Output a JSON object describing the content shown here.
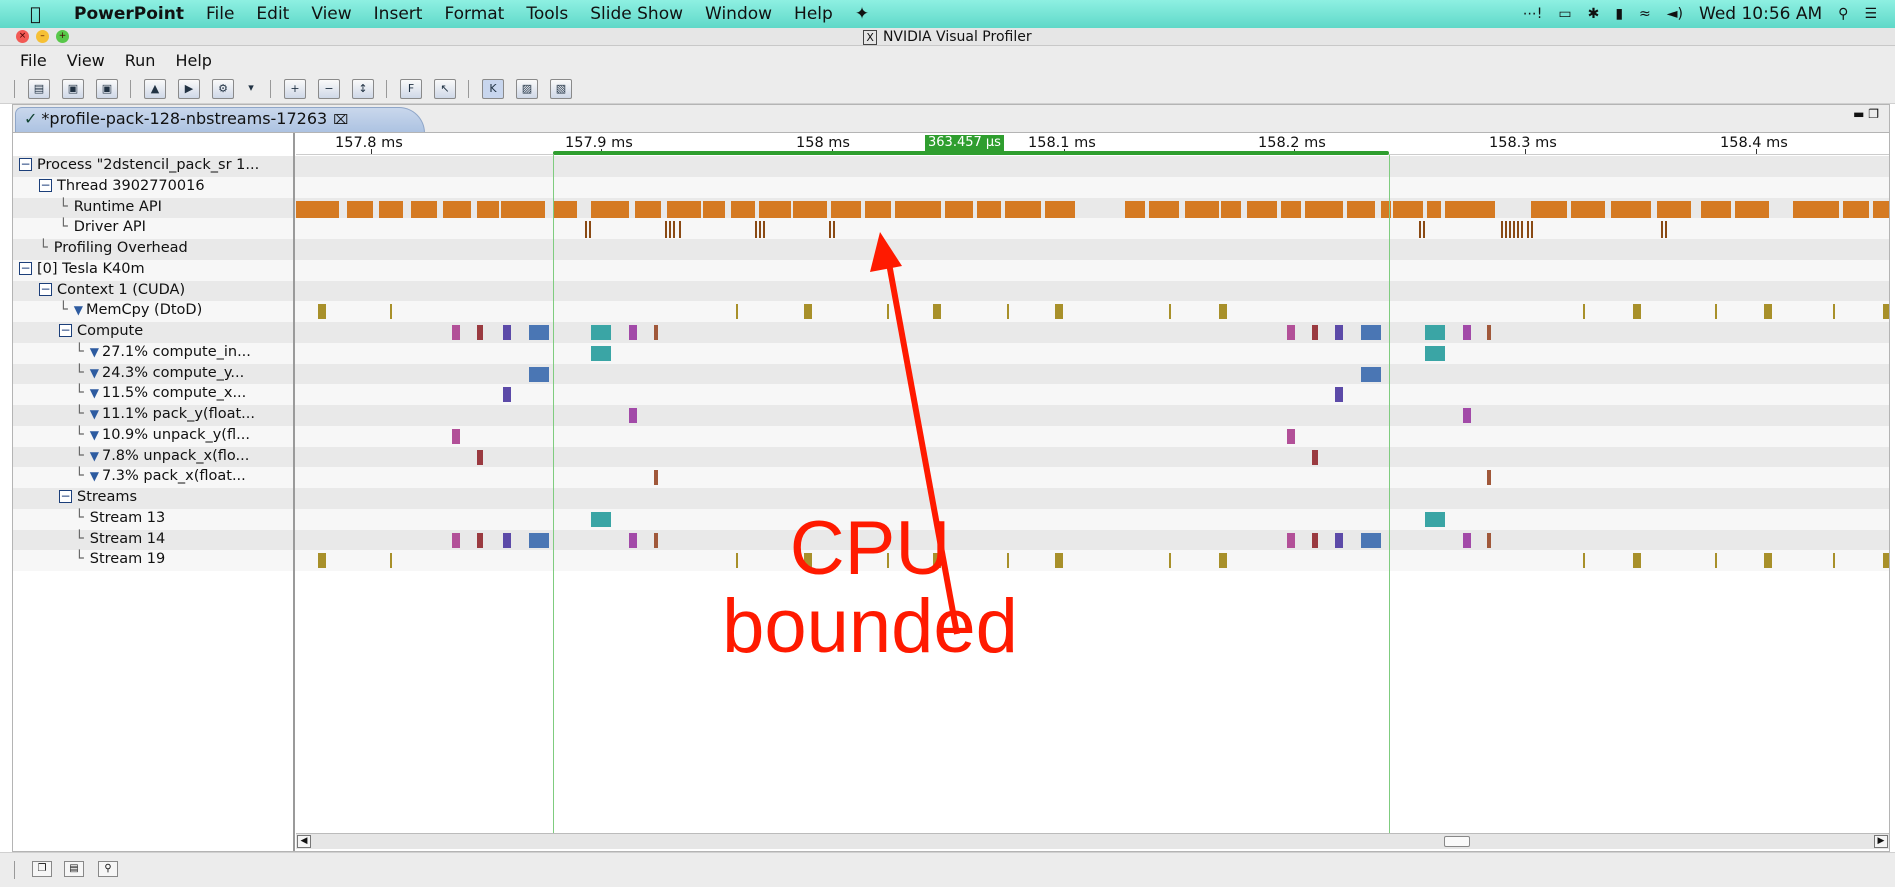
{
  "menubar": {
    "app": "PowerPoint",
    "items": [
      "File",
      "Edit",
      "View",
      "Insert",
      "Format",
      "Tools",
      "Slide Show",
      "Window",
      "Help"
    ],
    "clock": "Wed 10:56 AM"
  },
  "window": {
    "title": "NVIDIA Visual Profiler"
  },
  "app_menu": {
    "items": [
      "File",
      "View",
      "Run",
      "Help"
    ]
  },
  "tab": {
    "label": "*profile-pack-128-nbstreams-17263"
  },
  "ruler": {
    "ticks": [
      "157.8 ms",
      "157.9 ms",
      "158 ms",
      "158.1 ms",
      "158.2 ms",
      "158.3 ms",
      "158.4 ms"
    ],
    "selection_label": "363.457 µs"
  },
  "tree": {
    "rows": [
      {
        "label": "Process \"2dstencil_pack_sr 1...",
        "toggle": true,
        "funnel": false,
        "corner": false
      },
      {
        "label": "Thread 3902770016",
        "toggle": true,
        "funnel": false,
        "corner": false
      },
      {
        "label": "Runtime API",
        "toggle": false,
        "funnel": false,
        "corner": true
      },
      {
        "label": "Driver API",
        "toggle": false,
        "funnel": false,
        "corner": true
      },
      {
        "label": "Profiling Overhead",
        "toggle": false,
        "funnel": false,
        "corner": true
      },
      {
        "label": "[0] Tesla K40m",
        "toggle": true,
        "funnel": false,
        "corner": false
      },
      {
        "label": "Context 1 (CUDA)",
        "toggle": true,
        "funnel": false,
        "corner": false
      },
      {
        "label": "MemCpy (DtoD)",
        "toggle": false,
        "funnel": true,
        "corner": true
      },
      {
        "label": "Compute",
        "toggle": true,
        "funnel": false,
        "corner": false
      },
      {
        "label": "27.1% compute_in...",
        "toggle": false,
        "funnel": true,
        "corner": true
      },
      {
        "label": "24.3% compute_y...",
        "toggle": false,
        "funnel": true,
        "corner": true
      },
      {
        "label": "11.5% compute_x...",
        "toggle": false,
        "funnel": true,
        "corner": true
      },
      {
        "label": "11.1% pack_y(float...",
        "toggle": false,
        "funnel": true,
        "corner": true
      },
      {
        "label": "10.9% unpack_y(fl...",
        "toggle": false,
        "funnel": true,
        "corner": true
      },
      {
        "label": "7.8% unpack_x(flo...",
        "toggle": false,
        "funnel": true,
        "corner": true
      },
      {
        "label": "7.3% pack_x(float...",
        "toggle": false,
        "funnel": true,
        "corner": true
      },
      {
        "label": "Streams",
        "toggle": true,
        "funnel": false,
        "corner": false
      },
      {
        "label": "Stream 13",
        "toggle": false,
        "funnel": false,
        "corner": true
      },
      {
        "label": "Stream 14",
        "toggle": false,
        "funnel": false,
        "corner": true
      },
      {
        "label": "Stream 19",
        "toggle": false,
        "funnel": false,
        "corner": true
      }
    ]
  },
  "colors": {
    "runtime_api": "#d57a22",
    "driver_api": "#8a4a14",
    "memcpy": "#a8902a",
    "compute_in": "#3aa5a5",
    "compute_y": "#4a76b4",
    "compute_x": "#5c4aa8",
    "pack_y": "#a24aa8",
    "unpack_y": "#b25098",
    "unpack_x": "#9a3a40",
    "pack_x": "#a0583a",
    "selection": "#2f9e2f",
    "annotation": "#ff1a00"
  },
  "annotation": {
    "line1": "CPU",
    "line2": "bounded"
  }
}
